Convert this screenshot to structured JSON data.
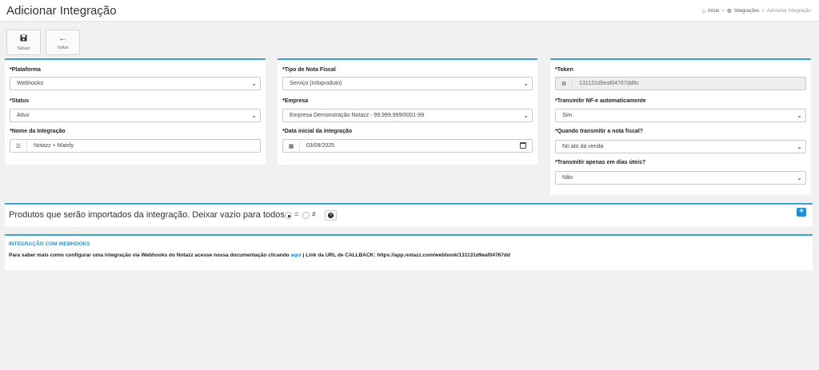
{
  "page": {
    "title": "Adicionar Integração"
  },
  "breadcrumb": [
    {
      "label": "Início",
      "icon": "home-icon"
    },
    {
      "label": "Integrações",
      "icon": "gears-icon"
    },
    {
      "label": "Adicionar Integração"
    }
  ],
  "toolbar": {
    "save_label": "Salvar",
    "back_label": "Voltar"
  },
  "form": {
    "plataforma": {
      "label": "*Plataforma",
      "value": "Webhooks"
    },
    "status": {
      "label": "*Status",
      "value": "Ativo"
    },
    "nome": {
      "label": "*Nome da Integração",
      "value": "Notazz + Maisfy"
    },
    "tipo_nota": {
      "label": "*Tipo de Nota Fiscal",
      "value": "Serviço (Infoproduto)"
    },
    "empresa": {
      "label": "*Empresa",
      "value": "Empresa Demonstração Notazz - 99.999.999/0001-99"
    },
    "data_inicial": {
      "label": "*Data inicial da integração",
      "value": "03/09/2025"
    },
    "token": {
      "label": "*Token",
      "value": "131131d9eaf04767dd8c"
    },
    "transmitir_auto": {
      "label": "*Transmitir NF-e automaticamente",
      "value": "Sim"
    },
    "quando_transmitir": {
      "label": "*Quando transmitir a nota fiscal?",
      "value": "No ato da venda"
    },
    "dias_uteis": {
      "label": "*Transmitir apenas em dias úteis?",
      "value": "Não"
    }
  },
  "products": {
    "text": "Produtos que serão importados da integração. Deixar vazio para todos.",
    "op_equal": "=",
    "op_not_equal": "≠",
    "selected": "="
  },
  "webhooks": {
    "title": "INTEGRAÇÃO COM WEBHOOKS",
    "text_before": "Para saber mais como configurar uma integração via Webhooks do Notazz acesse nossa documentação clicando ",
    "link": "aqui",
    "text_after": " | Link da URL de CALLBACK: https://app.notazz.com/webhook/131131d9eaf04767dd"
  },
  "colors": {
    "accent": "#3aa3d6",
    "primary_button": "#1c8fd6"
  }
}
